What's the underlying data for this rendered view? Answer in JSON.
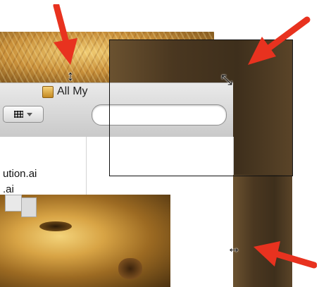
{
  "window": {
    "title": "All My",
    "filename_1": "ution.ai",
    "filename_2": ".ai"
  },
  "search": {
    "placeholder": ""
  },
  "icons": {
    "title_icon": "document-stack-icon",
    "view_icon": "grid-view-icon",
    "view_menu": "chevron-down-icon",
    "search_icon": "search-icon",
    "cursor_vertical": "resize-vertical-cursor",
    "cursor_diagonal": "resize-diagonal-cursor",
    "cursor_horizontal": "resize-horizontal-cursor"
  },
  "colors": {
    "arrow": "#e8321f",
    "frame": "#111111"
  }
}
